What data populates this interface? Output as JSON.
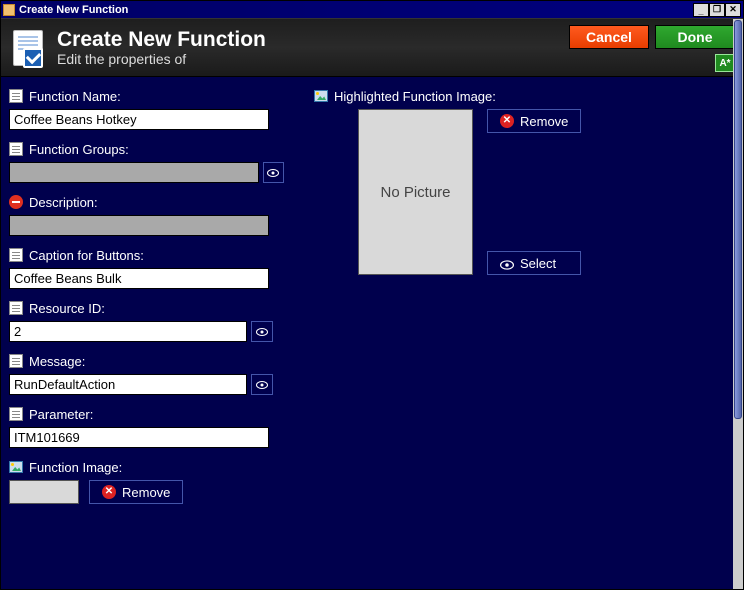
{
  "window": {
    "title": "Create New Function"
  },
  "header": {
    "title": "Create New Function",
    "subtitle": "Edit the properties of",
    "cancel_label": "Cancel",
    "done_label": "Done",
    "corner_label": "A*"
  },
  "left": {
    "function_name": {
      "label": "Function Name:",
      "value": "Coffee Beans Hotkey"
    },
    "function_groups": {
      "label": "Function Groups:",
      "value": ""
    },
    "description": {
      "label": "Description:",
      "value": ""
    },
    "caption": {
      "label": "Caption for Buttons:",
      "value": "Coffee Beans Bulk"
    },
    "resource_id": {
      "label": "Resource ID:",
      "value": "2"
    },
    "message": {
      "label": "Message:",
      "value": "RunDefaultAction"
    },
    "parameter": {
      "label": "Parameter:",
      "value": "ITM101669"
    },
    "function_image": {
      "label": "Function Image:",
      "remove_label": "Remove"
    }
  },
  "right": {
    "highlighted_image": {
      "label": "Highlighted Function Image:",
      "placeholder_text": "No Picture",
      "remove_label": "Remove",
      "select_label": "Select"
    }
  },
  "titlebar_buttons": {
    "min": "_",
    "max": "❐",
    "close": "✕"
  }
}
